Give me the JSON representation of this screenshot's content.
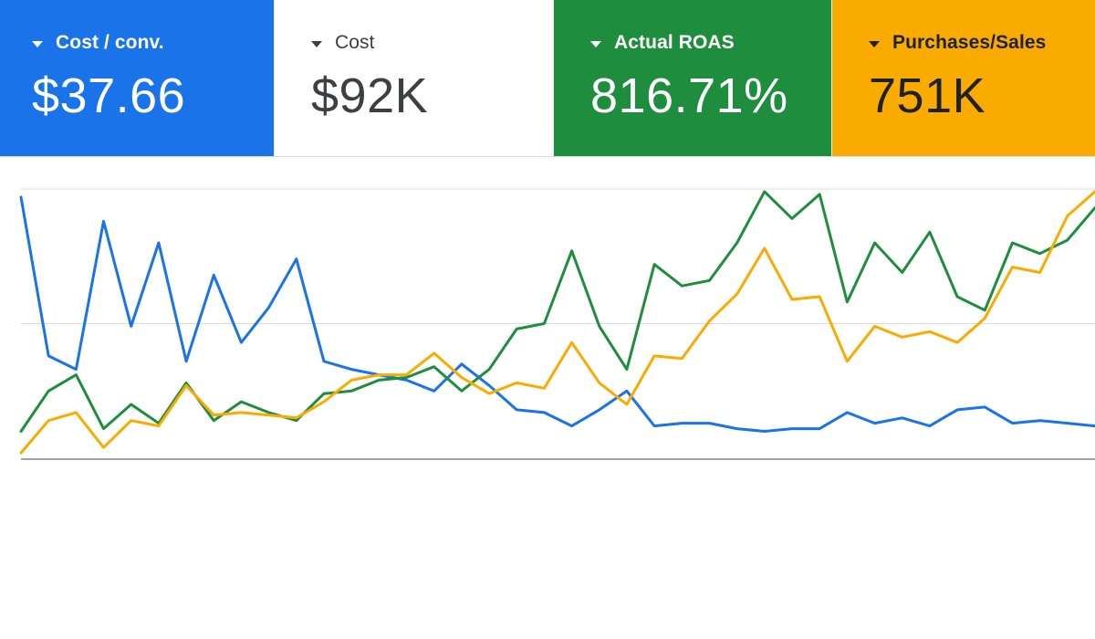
{
  "metrics": [
    {
      "label": "Cost / conv.",
      "value": "$37.66",
      "color": "#1a73e8",
      "selected": true
    },
    {
      "label": "Cost",
      "value": "$92K",
      "color": "#ffffff",
      "selected": false
    },
    {
      "label": "Actual ROAS",
      "value": "816.71%",
      "color": "#1e8e3e",
      "selected": true
    },
    {
      "label": "Purchases/Sales",
      "value": "751K",
      "color": "#f9ab00",
      "selected": true
    }
  ],
  "icons": {
    "dropdown": "caret-down-icon"
  },
  "chart_data": {
    "type": "line",
    "grid": true,
    "ylim": [
      0,
      100
    ],
    "x": [
      0,
      1,
      2,
      3,
      4,
      5,
      6,
      7,
      8,
      9,
      10,
      11,
      12,
      13,
      14,
      15,
      16,
      17,
      18,
      19,
      20,
      21,
      22,
      23,
      24,
      25,
      26,
      27,
      28,
      29,
      30,
      31,
      32,
      33,
      34,
      35,
      36,
      37,
      38,
      39
    ],
    "series": [
      {
        "metric": "Cost / conv.",
        "color": "#1a73e8",
        "values": [
          97,
          38,
          33,
          88,
          49,
          80,
          36,
          68,
          43,
          56,
          74,
          36,
          33,
          31,
          29,
          25,
          35,
          27,
          18,
          17,
          12,
          18,
          25,
          12,
          13,
          13,
          11,
          10,
          11,
          11,
          17,
          13,
          15,
          12,
          18,
          19,
          13,
          14,
          13,
          12
        ]
      },
      {
        "metric": "Actual ROAS",
        "color": "#1e8e3e",
        "values": [
          10,
          25,
          31,
          11,
          20,
          13,
          28,
          14,
          21,
          17,
          14,
          24,
          25,
          29,
          30,
          34,
          25,
          33,
          48,
          50,
          77,
          49,
          33,
          72,
          64,
          66,
          80,
          99,
          89,
          98,
          58,
          80,
          69,
          84,
          60,
          55,
          80,
          76,
          81,
          93
        ]
      },
      {
        "metric": "Purchases/Sales",
        "color": "#f9ab00",
        "values": [
          2,
          14,
          17,
          4,
          14,
          12,
          27,
          16,
          17,
          16,
          15,
          21,
          29,
          31,
          31,
          39,
          30,
          24,
          28,
          26,
          43,
          28,
          20,
          38,
          37,
          51,
          61,
          78,
          59,
          60,
          36,
          49,
          45,
          47,
          43,
          52,
          71,
          69,
          90,
          99
        ]
      }
    ]
  }
}
